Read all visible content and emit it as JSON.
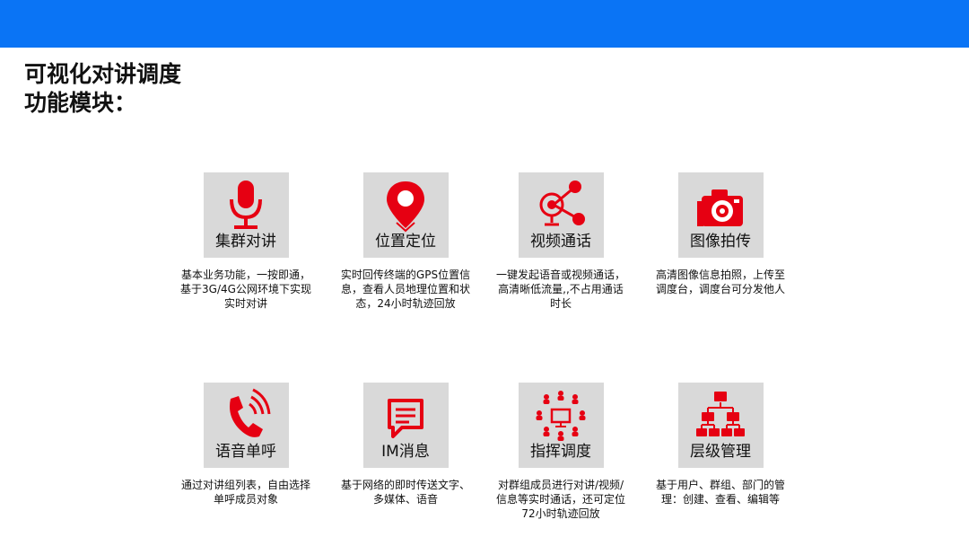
{
  "title": {
    "line1": "可视化对讲调度",
    "line2": "功能模块："
  },
  "colors": {
    "header_bar": "#0a74f5",
    "icon_accent": "#e60012",
    "tile_bg": "#d9d9d9"
  },
  "modules": [
    {
      "label": "集群对讲",
      "icon": "microphone-icon",
      "desc": "基本业务功能，一按即通，基于3G/4G公网环境下实现实时对讲"
    },
    {
      "label": "位置定位",
      "icon": "location-pin-icon",
      "desc": "实时回传终端的GPS位置信息，查看人员地理位置和状态，24小时轨迹回放"
    },
    {
      "label": "视频通话",
      "icon": "video-share-icon",
      "desc": "一键发起语音或视频通话，高清晰低流量,,不占用通话时长"
    },
    {
      "label": "图像拍传",
      "icon": "camera-icon",
      "desc": "高清图像信息拍照，上传至调度台，调度台可分发他人"
    },
    {
      "label": "语音单呼",
      "icon": "phone-icon",
      "desc": "通过对讲组列表，自由选择单呼成员对象"
    },
    {
      "label": "IM消息",
      "icon": "chat-icon",
      "desc": "基于网络的即时传送文字、多媒体、语音"
    },
    {
      "label": "指挥调度",
      "icon": "command-network-icon",
      "desc": "对群组成员进行对讲/视频/信息等实时通话，还可定位72小时轨迹回放"
    },
    {
      "label": "层级管理",
      "icon": "hierarchy-icon",
      "desc": "基于用户、群组、部门的管理：创建、查看、编辑等"
    }
  ]
}
